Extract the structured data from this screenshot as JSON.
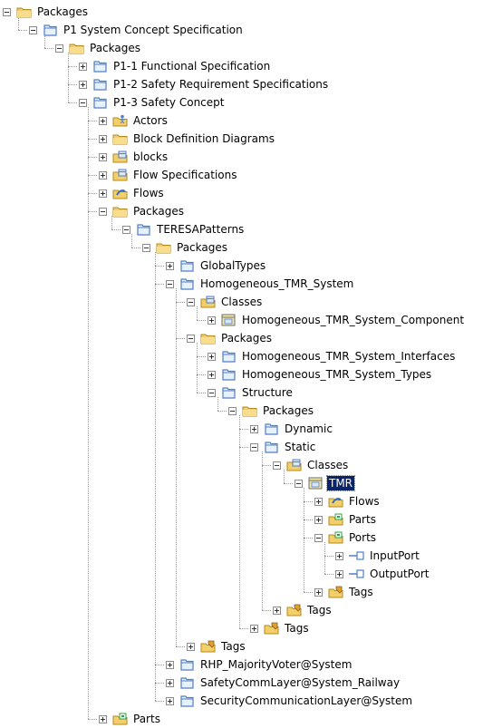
{
  "tree": [
    {
      "label": "Packages",
      "icon": "folder-icon",
      "expander": "minus"
    },
    {
      "label": "P1 System Concept Specification",
      "icon": "package-icon",
      "expander": "minus"
    },
    {
      "label": "Packages",
      "icon": "folder-icon",
      "expander": "minus"
    },
    {
      "label": "P1-1 Functional Specification",
      "icon": "package-icon",
      "expander": "plus"
    },
    {
      "label": "P1-2 Safety Requirement Specifications",
      "icon": "package-icon",
      "expander": "plus"
    },
    {
      "label": "P1-3 Safety Concept",
      "icon": "package-icon",
      "expander": "minus"
    },
    {
      "label": "Actors",
      "icon": "actors-folder-icon",
      "expander": "plus"
    },
    {
      "label": "Block Definition Diagrams",
      "icon": "folder-icon",
      "expander": "plus"
    },
    {
      "label": "blocks",
      "icon": "classes-folder-icon",
      "expander": "plus"
    },
    {
      "label": "Flow Specifications",
      "icon": "classes-folder-icon",
      "expander": "plus"
    },
    {
      "label": "Flows",
      "icon": "flows-folder-icon",
      "expander": "plus"
    },
    {
      "label": "Packages",
      "icon": "folder-icon",
      "expander": "minus"
    },
    {
      "label": "TERESAPatterns",
      "icon": "package-icon",
      "expander": "minus"
    },
    {
      "label": "Packages",
      "icon": "folder-icon",
      "expander": "minus"
    },
    {
      "label": "GlobalTypes",
      "icon": "package-icon",
      "expander": "plus"
    },
    {
      "label": "Homogeneous_TMR_System",
      "icon": "package-icon",
      "expander": "minus"
    },
    {
      "label": "Classes",
      "icon": "classes-folder-icon",
      "expander": "minus"
    },
    {
      "label": "Homogeneous_TMR_System_Component",
      "icon": "class-icon",
      "expander": "plus"
    },
    {
      "label": "Packages",
      "icon": "folder-icon",
      "expander": "minus"
    },
    {
      "label": "Homogeneous_TMR_System_Interfaces",
      "icon": "package-icon",
      "expander": "plus"
    },
    {
      "label": "Homogeneous_TMR_System_Types",
      "icon": "package-icon",
      "expander": "plus"
    },
    {
      "label": "Structure",
      "icon": "package-icon",
      "expander": "minus"
    },
    {
      "label": "Packages",
      "icon": "folder-icon",
      "expander": "minus"
    },
    {
      "label": "Dynamic",
      "icon": "package-icon",
      "expander": "plus"
    },
    {
      "label": "Static",
      "icon": "package-icon",
      "expander": "minus"
    },
    {
      "label": "Classes",
      "icon": "classes-folder-icon",
      "expander": "minus"
    },
    {
      "label": "TMR",
      "icon": "class-icon",
      "expander": "minus",
      "selected": true
    },
    {
      "label": "Flows",
      "icon": "flows-folder-icon",
      "expander": "plus"
    },
    {
      "label": "Parts",
      "icon": "parts-folder-icon",
      "expander": "plus"
    },
    {
      "label": "Ports",
      "icon": "parts-folder-icon",
      "expander": "minus"
    },
    {
      "label": "InputPort",
      "icon": "port-icon",
      "expander": "plus"
    },
    {
      "label": "OutputPort",
      "icon": "port-icon",
      "expander": "plus"
    },
    {
      "label": "Tags",
      "icon": "tags-folder-icon",
      "expander": "plus"
    },
    {
      "label": "Tags",
      "icon": "tags-folder-icon",
      "expander": "plus"
    },
    {
      "label": "Tags",
      "icon": "tags-folder-icon",
      "expander": "plus"
    },
    {
      "label": "Tags",
      "icon": "tags-folder-icon",
      "expander": "plus"
    },
    {
      "label": "RHP_MajorityVoter@System",
      "icon": "package-icon",
      "expander": "plus"
    },
    {
      "label": "SafetyCommLayer@System_Railway",
      "icon": "package-icon",
      "expander": "plus"
    },
    {
      "label": "SecurityCommunicationLayer@System",
      "icon": "package-icon",
      "expander": "plus"
    },
    {
      "label": "Parts",
      "icon": "parts-folder-icon",
      "expander": "plus"
    }
  ],
  "colors": {
    "selection": "#0a246a",
    "folder": "#f2cf6b",
    "package": "#4f7fc8",
    "accent_green": "#2f9e44",
    "accent_pink": "#d63a8a"
  }
}
